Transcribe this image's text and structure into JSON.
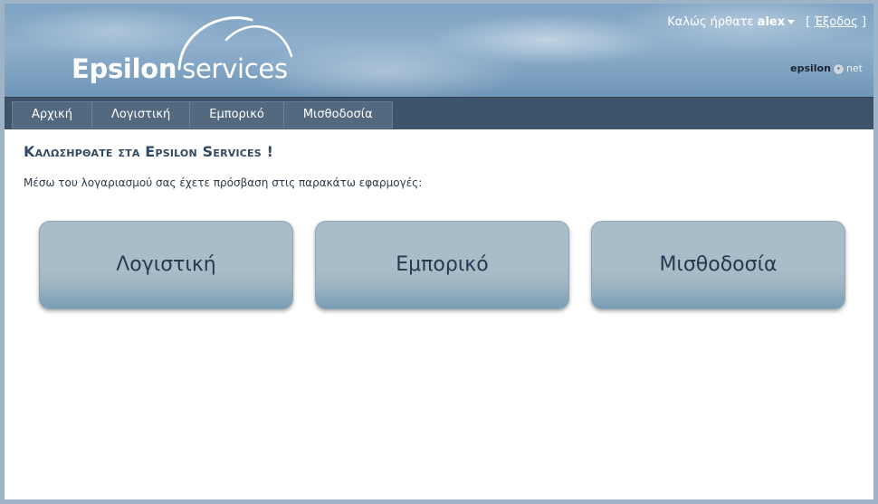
{
  "header": {
    "logo_word1": "Epsilon",
    "logo_word2": "services",
    "welcome_prefix": "Καλώς ήρθατε",
    "username": "alex",
    "logout_open": "[",
    "logout_label": "Έξοδος",
    "logout_close": "]",
    "brand_part1": "epsilon",
    "brand_dot": "•",
    "brand_part2": "net"
  },
  "nav": {
    "items": [
      "Αρχική",
      "Λογιστική",
      "Εμπορικό",
      "Μισθοδοσία"
    ]
  },
  "main": {
    "title": "Καλωσηρθατε στα Epsilon Services !",
    "intro": "Μέσω του λογαριασμού σας έχετε πρόσβαση στις παρακάτω εφαρμογές:",
    "tiles": [
      "Λογιστική",
      "Εμπορικό",
      "Μισθοδοσία"
    ]
  },
  "colors": {
    "nav_bar": "#3e546b",
    "title": "#2f4a62",
    "tile": "#a9bdc8"
  },
  "icons": {
    "user_menu": "caret-down-icon",
    "logo_graphic": "cloud-arc-icon"
  }
}
